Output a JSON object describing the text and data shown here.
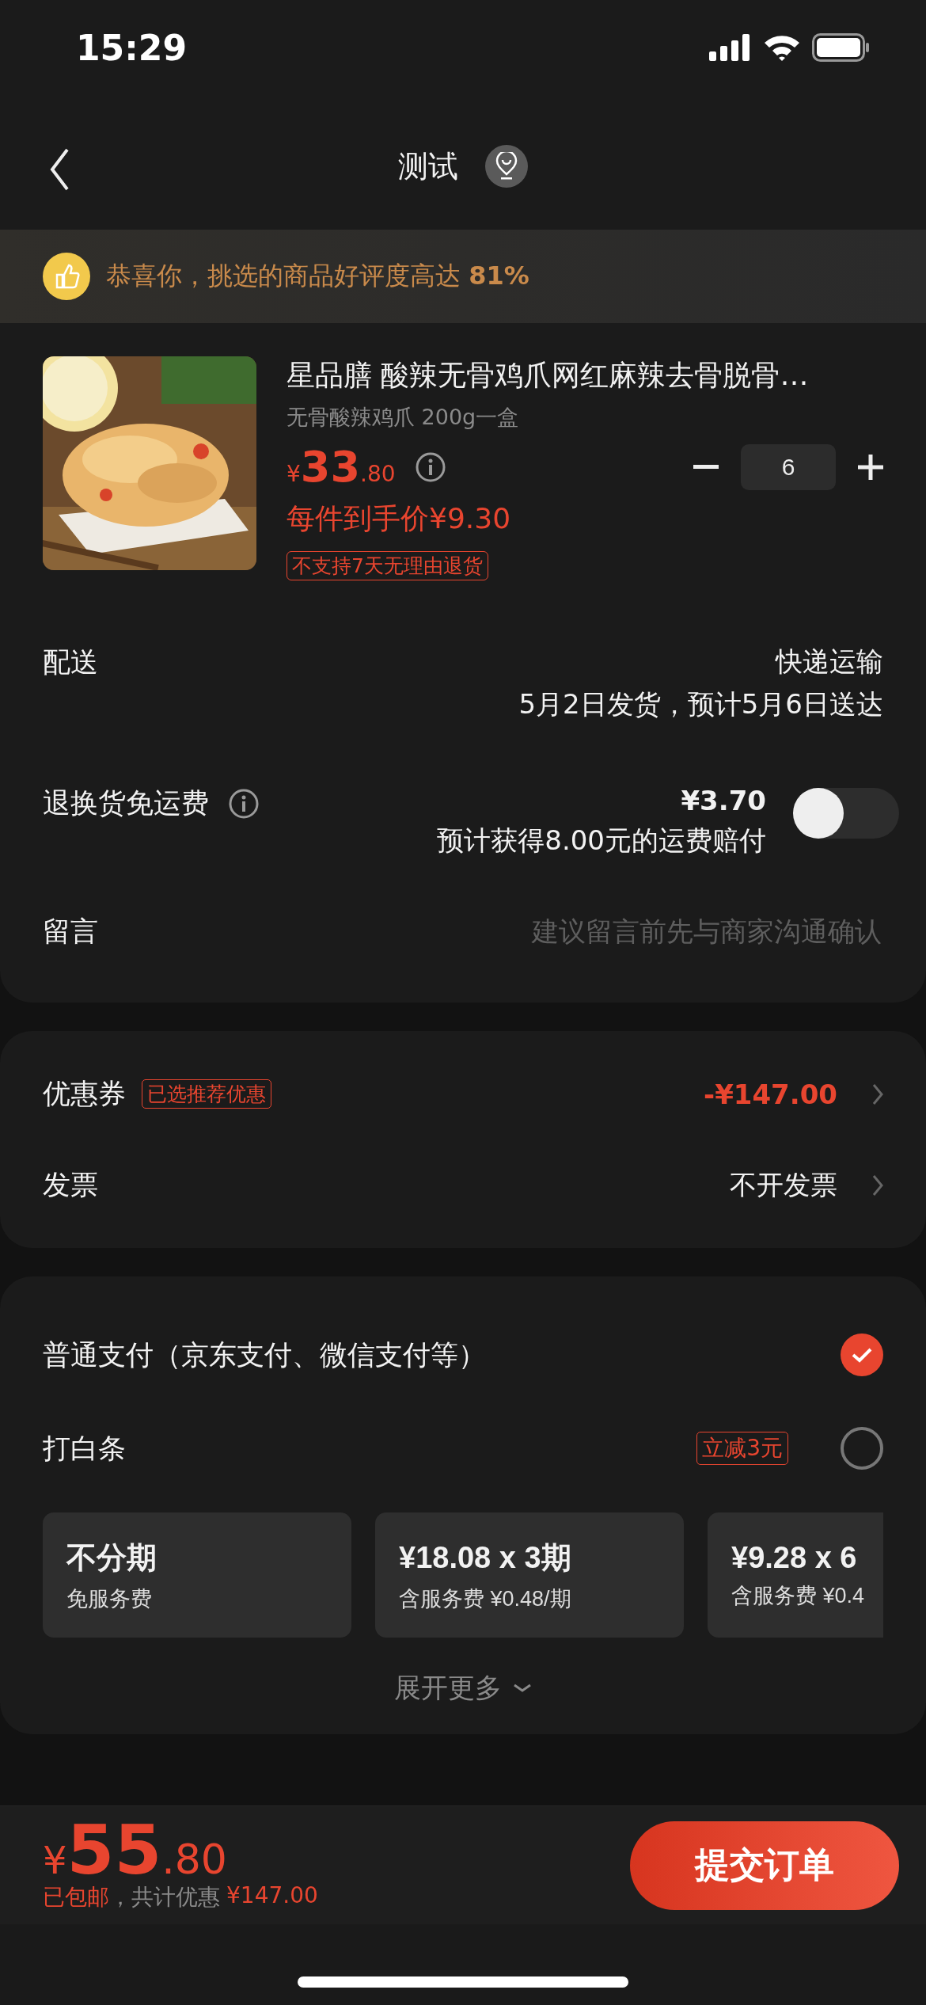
{
  "status_bar": {
    "time": "15:29"
  },
  "nav": {
    "title": "测试"
  },
  "banner": {
    "text": "恭喜你，挑选的商品好评度高达 **81%**"
  },
  "product": {
    "title": "星品膳 酸辣无骨鸡爪网红麻辣去骨脱骨…",
    "spec": "无骨酸辣鸡爪 200g一盒",
    "currency": "¥",
    "price_integer": "33",
    "price_decimal": ".80",
    "unit_price": "每件到手价¥9.30",
    "tag": "不支持7天无理由退货",
    "quantity": "6"
  },
  "delivery": {
    "label": "配送",
    "method": "快递运输",
    "schedule": "5月2日发货，预计5月6日送达"
  },
  "return_insurance": {
    "label": "退换货免运费",
    "price": "¥3.70",
    "note": "预计获得8.00元的运费赔付",
    "on": false
  },
  "message": {
    "label": "留言",
    "placeholder": "建议留言前先与商家沟通确认"
  },
  "coupon": {
    "label": "优惠券",
    "tag": "已选推荐优惠",
    "value": "-¥147.00"
  },
  "invoice": {
    "label": "发票",
    "value": "不开发票"
  },
  "payment_options": [
    {
      "label": "普通支付（京东支付、微信支付等）",
      "selected": true
    },
    {
      "label": "打白条",
      "badge": "立减3元",
      "selected": false
    }
  ],
  "installments": [
    {
      "title": "不分期",
      "subtitle": "免服务费",
      "selected": false
    },
    {
      "title": "¥18.08 x 3期",
      "subtitle": "含服务费 ¥0.48/期",
      "selected": false
    },
    {
      "title": "¥9.28 x 6",
      "subtitle": "含服务费 ¥0.4",
      "selected": false
    }
  ],
  "expand": "展开更多",
  "footer": {
    "currency": "¥",
    "total_integer": "55",
    "total_decimal": ".80",
    "shipping": "已包邮",
    "discount_label": "，共计优惠",
    "discount": "¥147.00",
    "submit": "提交订单"
  }
}
